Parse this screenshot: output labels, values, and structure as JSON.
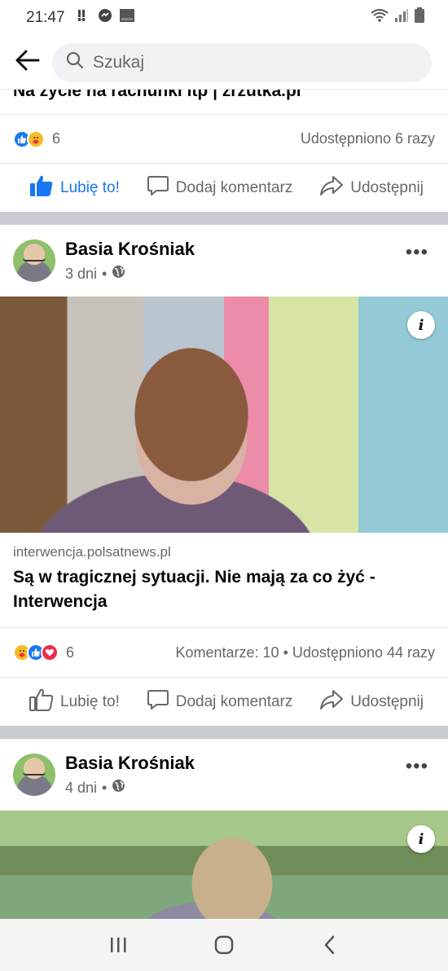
{
  "status_bar": {
    "time": "21:47",
    "left_icons": [
      "sms-icon",
      "messenger-icon",
      "carrier-icon"
    ],
    "right_icons": [
      "wifi-icon",
      "signal-icon",
      "battery-icon"
    ]
  },
  "header": {
    "back_icon": "back-arrow-icon",
    "search_icon": "search-icon",
    "search_placeholder": "Szukaj"
  },
  "previous_post": {
    "cut_title": "Na życie na rachunki itp | zrzutka.pl",
    "reaction_count": "6",
    "shares": "Udostępniono 6 razy",
    "actions": {
      "like": "Lubię to!",
      "comment": "Dodaj komentarz",
      "share": "Udostępnij"
    },
    "liked": true
  },
  "posts": [
    {
      "author": "Basia Krośniak",
      "time": "3 dni",
      "link_domain": "interwencja.polsatnews.pl",
      "link_title": "Są w tragicznej sytuacji. Nie mają za co żyć - Interwencja",
      "reaction_count": "6",
      "stats": "Komentarze: 10 • Udostępniono 44 razy",
      "actions": {
        "like": "Lubię to!",
        "comment": "Dodaj komentarz",
        "share": "Udostępnij"
      }
    },
    {
      "author": "Basia Krośniak",
      "time": "4 dni"
    }
  ],
  "colors": {
    "accent": "#1877f2",
    "love": "#f02849",
    "care": "#f7b928",
    "separator": "#c9ccd1",
    "secondary_text": "#65676b"
  }
}
